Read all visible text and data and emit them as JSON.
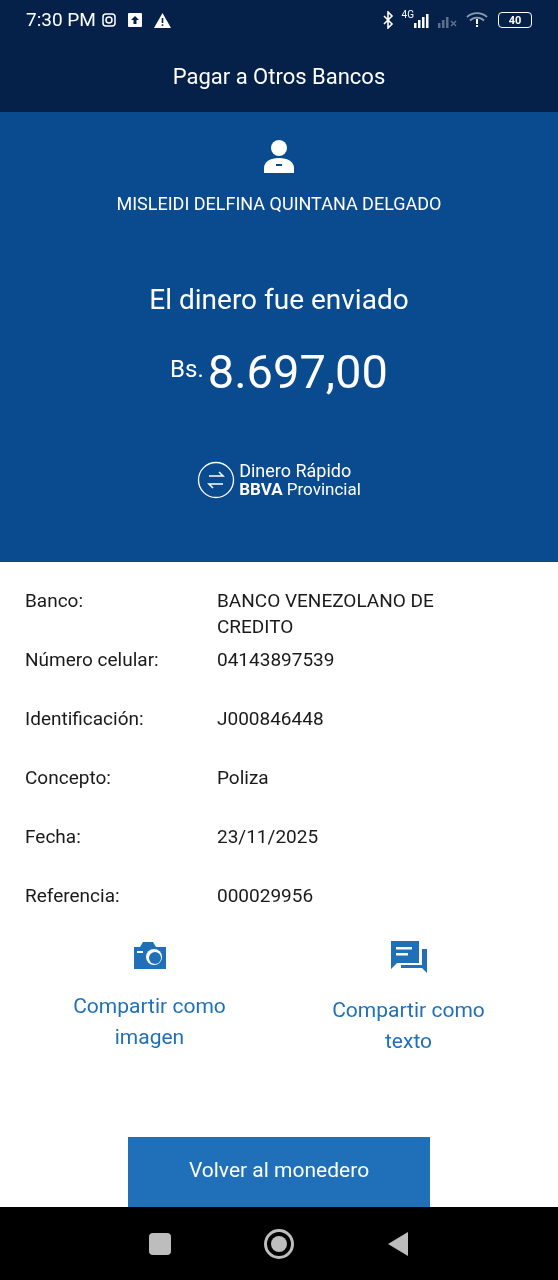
{
  "status_bar": {
    "time": "7:30 PM",
    "network": "4G",
    "battery": "40"
  },
  "header": {
    "title": "Pagar a Otros Bancos"
  },
  "receipt": {
    "recipient": "MISLEIDI DELFINA QUINTANA DELGADO",
    "message": "El dinero fue enviado",
    "currency": "Bs.",
    "amount": "8.697,00",
    "brand_line_1": "Dinero Rápido",
    "brand_line_2": "**BBVA** Provincial"
  },
  "details": [
    {
      "label": "Banco:",
      "value": "BANCO VENEZOLANO DE CREDITO"
    },
    {
      "label": "Número celular:",
      "value": "04143897539"
    },
    {
      "label": "Identificación:",
      "value": "J000846448"
    },
    {
      "label": "Concepto:",
      "value": "Poliza"
    },
    {
      "label": "Fecha:",
      "value": "23/11/2025"
    },
    {
      "label": "Referencia:",
      "value": "000029956"
    }
  ],
  "share_actions": [
    {
      "kind": "image",
      "label": "Compartir como imagen"
    },
    {
      "kind": "text",
      "label": "Compartir como texto"
    }
  ],
  "primary_button": "Volver al monedero"
}
